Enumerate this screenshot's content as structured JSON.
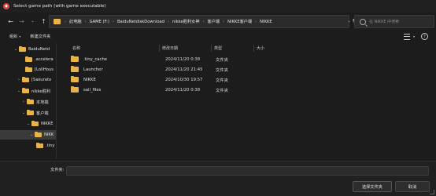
{
  "window": {
    "title": "Select game path (with game executable)"
  },
  "nav": {
    "breadcrumbs": [
      "此电脑",
      "GAME (F:)",
      "BaiduNetdiskDownload",
      "nikke胜利女神",
      "客户端",
      "NIKKE客户端",
      "NIKKE"
    ],
    "search_placeholder": "在 NIKKE 中搜索"
  },
  "toolbar": {
    "organize_label": "组织",
    "new_folder_label": "新建文件夹"
  },
  "sidebar": {
    "items": [
      {
        "label": "BaiduNetd"
      },
      {
        "label": ".accelera"
      },
      {
        "label": "[LoliHous"
      },
      {
        "label": "[Sakurato"
      },
      {
        "label": "nikke胜利"
      },
      {
        "label": "本地端"
      },
      {
        "label": "客户端"
      },
      {
        "label": "NIKKE"
      },
      {
        "label": "NIKK"
      },
      {
        "label": ".tiny"
      }
    ]
  },
  "table": {
    "columns": [
      "名称",
      "修改日期",
      "类型",
      "大小"
    ],
    "rows": [
      {
        "name": ".tiny_cache",
        "date": "2024/11/20 0:38",
        "type": "文件夹"
      },
      {
        "name": "Launcher",
        "date": "2024/11/20 21:45",
        "type": "文件夹"
      },
      {
        "name": "NIKKE",
        "date": "2024/10/30 19:57",
        "type": "文件夹"
      },
      {
        "name": "sail_files",
        "date": "2024/11/20 0:38",
        "type": "文件夹"
      }
    ]
  },
  "footer": {
    "filename_label": "文件夹:",
    "filename_value": "",
    "select_button": "选择文件夹",
    "cancel_button": "取消"
  },
  "colors": {
    "background": "#1c1c1c",
    "folder": "#e8b44a",
    "accent_icon": "#d94848"
  }
}
